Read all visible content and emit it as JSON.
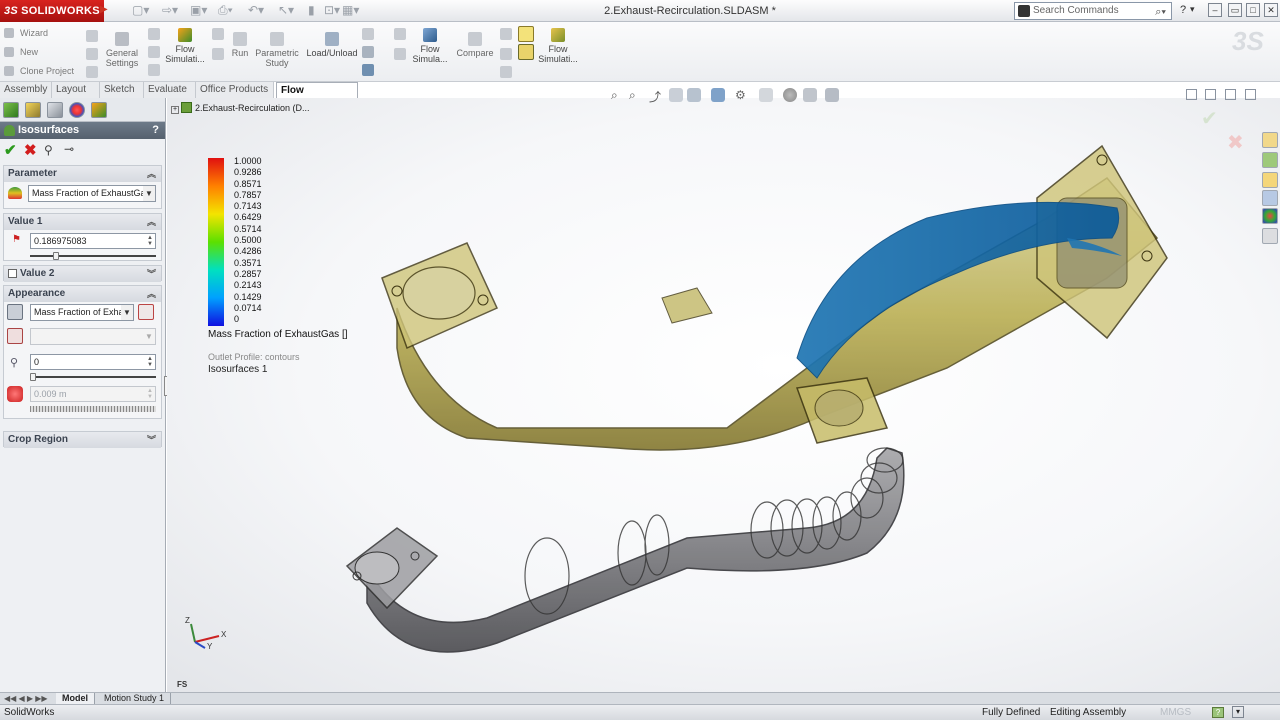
{
  "app": {
    "brand": "SOLIDWORKS",
    "brand_mark": "3S",
    "document_title": "2.Exhaust-Recirculation.SLDASM *",
    "search_placeholder": "Search Commands",
    "help_label": "?",
    "accent_color": "#d4201b"
  },
  "command_manager": {
    "left_items": [
      "Wizard",
      "New",
      "Clone Project"
    ],
    "buttons": [
      {
        "label": "General Settings",
        "icon": "gear-icon"
      },
      {
        "label": "Flow Simulati...",
        "icon": "flow-sim-icon"
      },
      {
        "label": "Run",
        "icon": "run-icon"
      },
      {
        "label": "Parametric Study",
        "icon": "parametric-icon"
      },
      {
        "label": "Load/Unload",
        "icon": "load-icon"
      },
      {
        "label": "Flow Simula...",
        "icon": "flow-sim-icon"
      },
      {
        "label": "Compare",
        "icon": "compare-icon"
      },
      {
        "label": "Flow Simulati...",
        "icon": "flow-sim-icon"
      }
    ]
  },
  "tabs": [
    {
      "label": "Assembly"
    },
    {
      "label": "Layout"
    },
    {
      "label": "Sketch"
    },
    {
      "label": "Evaluate"
    },
    {
      "label": "Office Products"
    },
    {
      "label": "Flow Simulation",
      "active": true
    }
  ],
  "property_manager": {
    "title": "Isosurfaces",
    "help": "?",
    "parameter": {
      "heading": "Parameter",
      "selected": "Mass Fraction of ExhaustGa"
    },
    "value1": {
      "heading": "Value 1",
      "value": "0.186975083",
      "slider_fraction": 0.19
    },
    "value2": {
      "heading": "Value 2",
      "checked": false
    },
    "appearance": {
      "heading": "Appearance",
      "color_by": "Mass Fraction of Exhau",
      "transparency": "0",
      "mesh_size": "0.009 m"
    },
    "crop_region": {
      "heading": "Crop Region"
    }
  },
  "feature_tree": {
    "root_label": "2.Exhaust-Recirculation (D..."
  },
  "legend": {
    "ticks": [
      "1.0000",
      "0.9286",
      "0.8571",
      "0.7857",
      "0.7143",
      "0.6429",
      "0.5714",
      "0.5000",
      "0.4286",
      "0.3571",
      "0.2857",
      "0.2143",
      "0.1429",
      "0.0714",
      "0"
    ],
    "title": "Mass Fraction of ExhaustGas []",
    "subtitle": "Outlet Profile: contours",
    "layer": "Isosurfaces 1",
    "colors": [
      "#e01010",
      "#ff8000",
      "#f4e400",
      "#5ce000",
      "#00e0c0",
      "#00a0ff",
      "#1010e0"
    ]
  },
  "triad": {
    "z": "Z",
    "y": "Y",
    "x": "X"
  },
  "fs_label": "FS",
  "bottom_tabs": [
    "Model",
    "Motion Study 1"
  ],
  "status": {
    "app_name": "SolidWorks",
    "state": "Fully Defined",
    "mode": "Editing Assembly",
    "units": "MMGS"
  }
}
